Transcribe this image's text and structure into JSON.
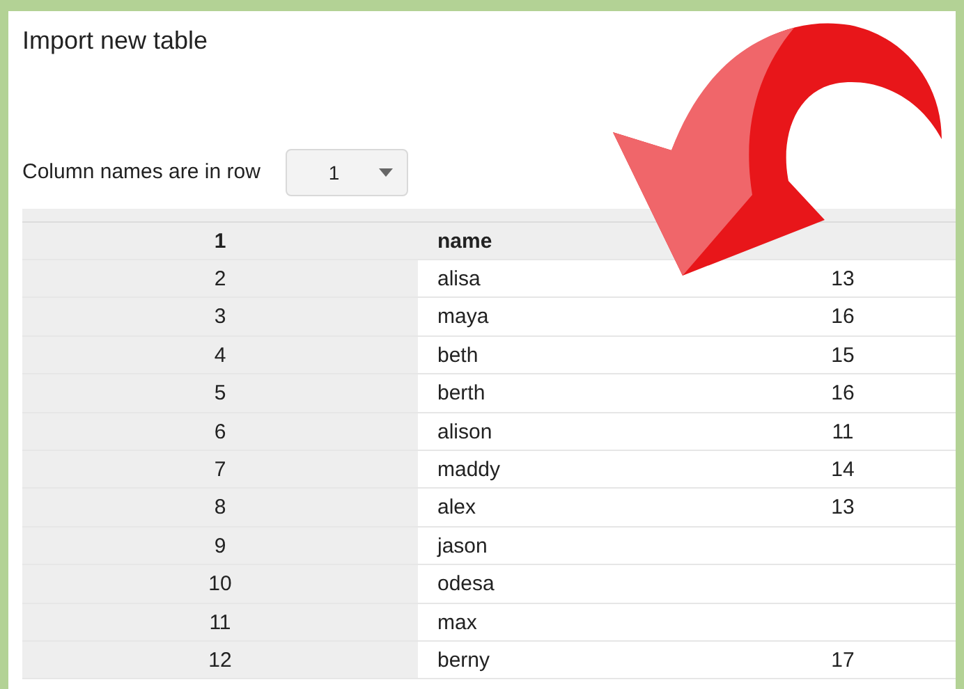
{
  "title": "Import new table",
  "header_row": {
    "label": "Column names are in row",
    "value": "1"
  },
  "table": {
    "header": [
      "1",
      "name"
    ],
    "rows": [
      {
        "cells": [
          "2",
          "alisa",
          "13"
        ]
      },
      {
        "cells": [
          "3",
          "maya",
          "16"
        ]
      },
      {
        "cells": [
          "4",
          "beth",
          "15"
        ]
      },
      {
        "cells": [
          "5",
          "berth",
          "16"
        ]
      },
      {
        "cells": [
          "6",
          "alison",
          "11"
        ]
      },
      {
        "cells": [
          "7",
          "maddy",
          "14"
        ]
      },
      {
        "cells": [
          "8",
          "alex",
          "13"
        ]
      },
      {
        "cells": [
          "9",
          "jason"
        ]
      },
      {
        "cells": [
          "10",
          "odesa"
        ]
      },
      {
        "cells": [
          "11",
          "max"
        ]
      },
      {
        "cells": [
          "12",
          "berny",
          "17"
        ]
      }
    ]
  }
}
